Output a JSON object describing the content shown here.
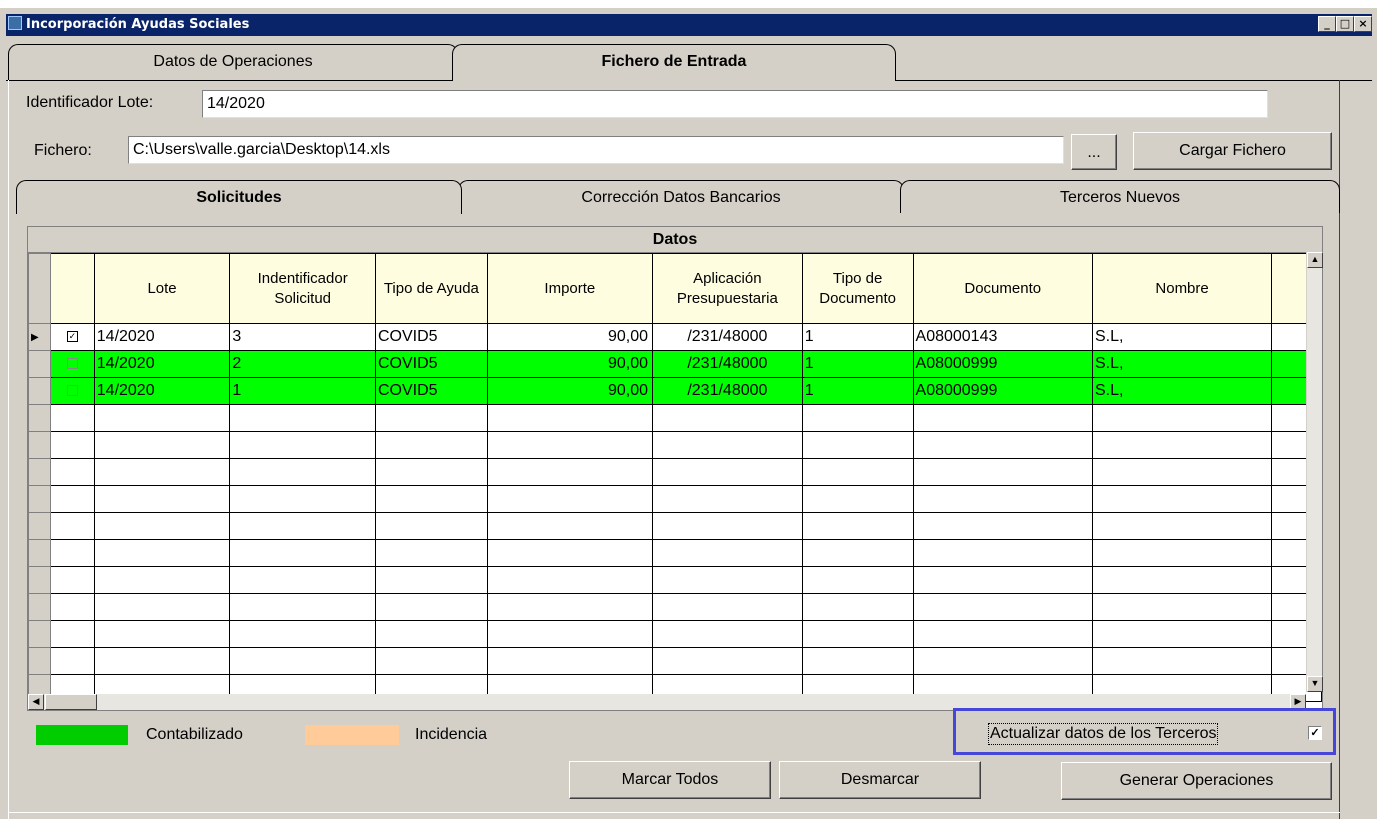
{
  "window": {
    "title": "Incorporación Ayudas Sociales",
    "min_label": "_",
    "max_label": "□",
    "close_label": "×"
  },
  "tabs": [
    {
      "label": "Datos de Operaciones",
      "active": false
    },
    {
      "label": "Fichero de Entrada",
      "active": true
    }
  ],
  "form": {
    "lote_label": "Identificador Lote:",
    "lote_value": "14/2020",
    "fichero_label": "Fichero:",
    "fichero_value": "C:\\Users\\valle.garcia\\Desktop\\14.xls",
    "browse_label": "...",
    "load_label": "Cargar Fichero"
  },
  "inner_tabs": [
    {
      "label": "Solicitudes",
      "active": true
    },
    {
      "label": "Corrección Datos Bancarios",
      "active": false
    },
    {
      "label": "Terceros Nuevos",
      "active": false
    }
  ],
  "grid": {
    "caption": "Datos",
    "columns": [
      "Lote",
      "Indentificador Solicitud",
      "Tipo de Ayuda",
      "Importe",
      "Aplicación Presupuestaria",
      "Tipo de Documento",
      "Documento",
      "Nombre"
    ],
    "rows": [
      {
        "checked": true,
        "status": "normal",
        "cells": [
          "14/2020",
          "3",
          "COVID5",
          "90,00",
          "/231/48000",
          "1",
          "A08000143",
          "S.L,"
        ]
      },
      {
        "checked": false,
        "status": "contabilizado",
        "cells": [
          "14/2020",
          "2",
          "COVID5",
          "90,00",
          "/231/48000",
          "1",
          "A08000999",
          "S.L,"
        ]
      },
      {
        "checked": false,
        "status": "contabilizado",
        "cells": [
          "14/2020",
          "1",
          "COVID5",
          "90,00",
          "/231/48000",
          "1",
          "A08000999",
          "S.L,"
        ]
      }
    ],
    "empty_rows": 11
  },
  "legend": {
    "contabilizado_label": "Contabilizado",
    "contabilizado_color": "#00cc00",
    "incidencia_label": "Incidencia",
    "incidencia_color": "#ffcc99"
  },
  "actualizar": {
    "label": "Actualizar datos de los Terceros",
    "checked": true
  },
  "buttons": {
    "marcar": "Marcar Todos",
    "desmarcar": "Desmarcar",
    "generar": "Generar Operaciones"
  }
}
